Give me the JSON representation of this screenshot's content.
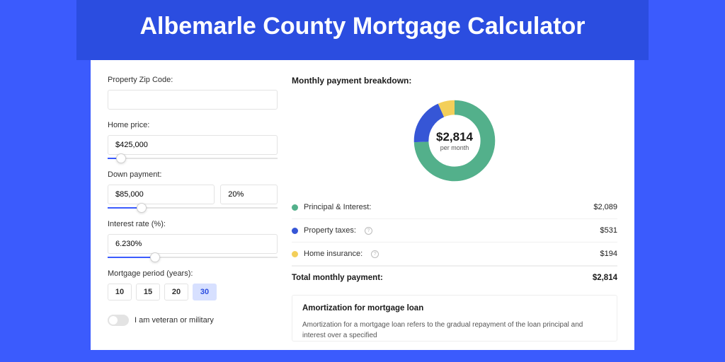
{
  "header": {
    "title": "Albemarle County Mortgage Calculator"
  },
  "form": {
    "zip": {
      "label": "Property Zip Code:",
      "value": ""
    },
    "price": {
      "label": "Home price:",
      "value": "$425,000",
      "slider_pct": 8
    },
    "down": {
      "label": "Down payment:",
      "amount": "$85,000",
      "pct": "20%",
      "slider_pct": 20
    },
    "rate": {
      "label": "Interest rate (%):",
      "value": "6.230%",
      "slider_pct": 28
    },
    "period": {
      "label": "Mortgage period (years):",
      "options": [
        "10",
        "15",
        "20",
        "30"
      ],
      "active": "30"
    },
    "veteran": {
      "label": "I am veteran or military",
      "on": false
    }
  },
  "breakdown": {
    "title": "Monthly payment breakdown:",
    "center_amount": "$2,814",
    "center_sub": "per month",
    "items": [
      {
        "label": "Principal & Interest:",
        "value": "$2,089",
        "color": "#53b08b",
        "info": false
      },
      {
        "label": "Property taxes:",
        "value": "$531",
        "color": "#3656d6",
        "info": true
      },
      {
        "label": "Home insurance:",
        "value": "$194",
        "color": "#f3cf5a",
        "info": true
      }
    ],
    "total": {
      "label": "Total monthly payment:",
      "value": "$2,814"
    }
  },
  "amort": {
    "title": "Amortization for mortgage loan",
    "text": "Amortization for a mortgage loan refers to the gradual repayment of the loan principal and interest over a specified"
  },
  "chart_data": {
    "type": "pie",
    "title": "Monthly payment breakdown",
    "categories": [
      "Principal & Interest",
      "Property taxes",
      "Home insurance"
    ],
    "values": [
      2089,
      531,
      194
    ],
    "colors": [
      "#53b08b",
      "#3656d6",
      "#f3cf5a"
    ],
    "total": 2814,
    "unit": "USD"
  }
}
